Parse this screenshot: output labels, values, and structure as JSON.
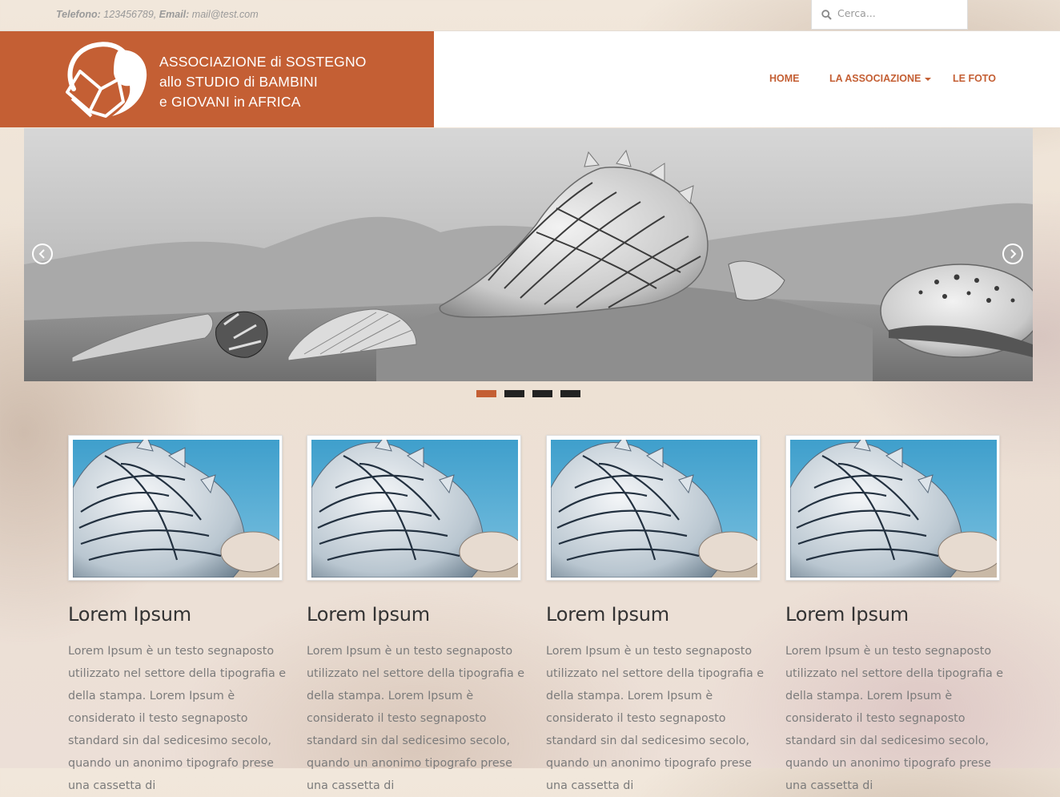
{
  "topbar": {
    "phone_label": "Telefono:",
    "phone_value": "123456789,",
    "email_label": "Email:",
    "email_value": "mail@test.com",
    "search_placeholder": "Cerca..."
  },
  "logo": {
    "line1": "ASSOCIAZIONE di SOSTEGNO",
    "line2": "allo STUDIO di BAMBINI",
    "line3": "e GIOVANI in AFRICA"
  },
  "nav": {
    "items": [
      {
        "label": "HOME"
      },
      {
        "label": "LA ASSOCIAZIONE",
        "has_dropdown": true
      },
      {
        "label": "LE FOTO"
      }
    ]
  },
  "slider": {
    "slide_count": 4,
    "active_slide": 1,
    "prev_icon": "chevron-left-icon",
    "next_icon": "chevron-right-icon"
  },
  "cards": [
    {
      "title": "Lorem Ipsum",
      "text": "Lorem Ipsum è un testo segnaposto utilizzato nel settore della tipografia e della stampa. Lorem Ipsum è considerato il testo segnaposto standard sin dal sedicesimo secolo, quando un anonimo tipografo prese una cassetta di"
    },
    {
      "title": "Lorem Ipsum",
      "text": "Lorem Ipsum è un testo segnaposto utilizzato nel settore della tipografia e della stampa. Lorem Ipsum è considerato il testo segnaposto standard sin dal sedicesimo secolo, quando un anonimo tipografo prese una cassetta di"
    },
    {
      "title": "Lorem Ipsum",
      "text": "Lorem Ipsum è un testo segnaposto utilizzato nel settore della tipografia e della stampa. Lorem Ipsum è considerato il testo segnaposto standard sin dal sedicesimo secolo, quando un anonimo tipografo prese una cassetta di"
    },
    {
      "title": "Lorem Ipsum",
      "text": "Lorem Ipsum è un testo segnaposto utilizzato nel settore della tipografia e della stampa. Lorem Ipsum è considerato il testo segnaposto standard sin dal sedicesimo secolo, quando un anonimo tipografo prese una cassetta di"
    }
  ],
  "colors": {
    "accent": "#c45f34",
    "dot_inactive": "#222222",
    "text_body": "#7b7b7b",
    "text_heading": "#333333"
  }
}
